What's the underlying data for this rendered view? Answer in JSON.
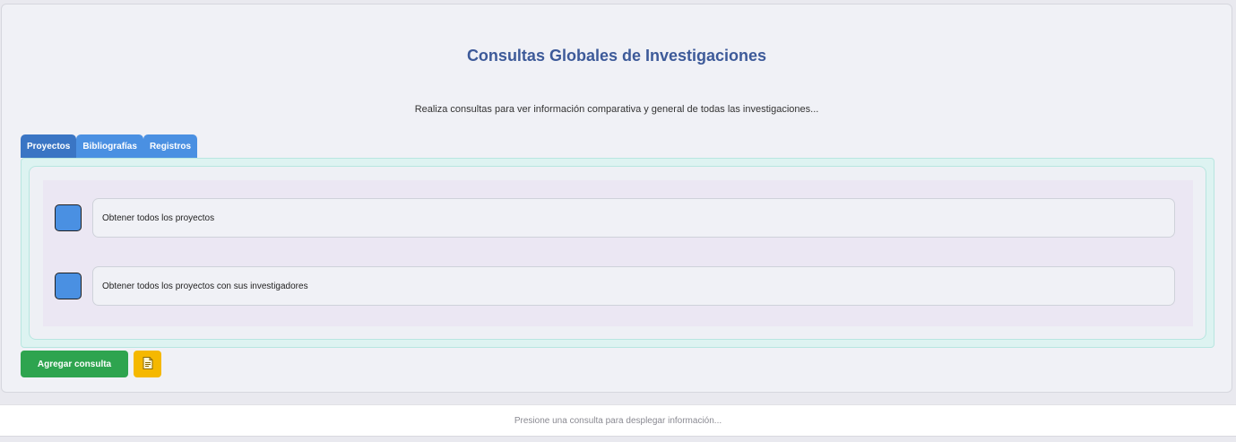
{
  "page": {
    "title": "Consultas Globales de Investigaciones",
    "subtitle": "Realiza consultas para ver información comparativa y general de todas las investigaciones..."
  },
  "tabs": [
    {
      "label": "Proyectos",
      "active": true
    },
    {
      "label": "Bibliografías",
      "active": false
    },
    {
      "label": "Registros",
      "active": false
    }
  ],
  "queries": [
    {
      "label": "Obtener todos los proyectos"
    },
    {
      "label": "Obtener todos los proyectos con sus investigadores"
    }
  ],
  "actions": {
    "add_query_label": "Agregar consulta",
    "document_icon": "document-icon"
  },
  "footer": {
    "message": "Presione una consulta para desplegar información..."
  },
  "colors": {
    "title": "#3d5a99",
    "tab": "#4a90e2",
    "add_button": "#2ea44f",
    "doc_button": "#f5b800"
  }
}
